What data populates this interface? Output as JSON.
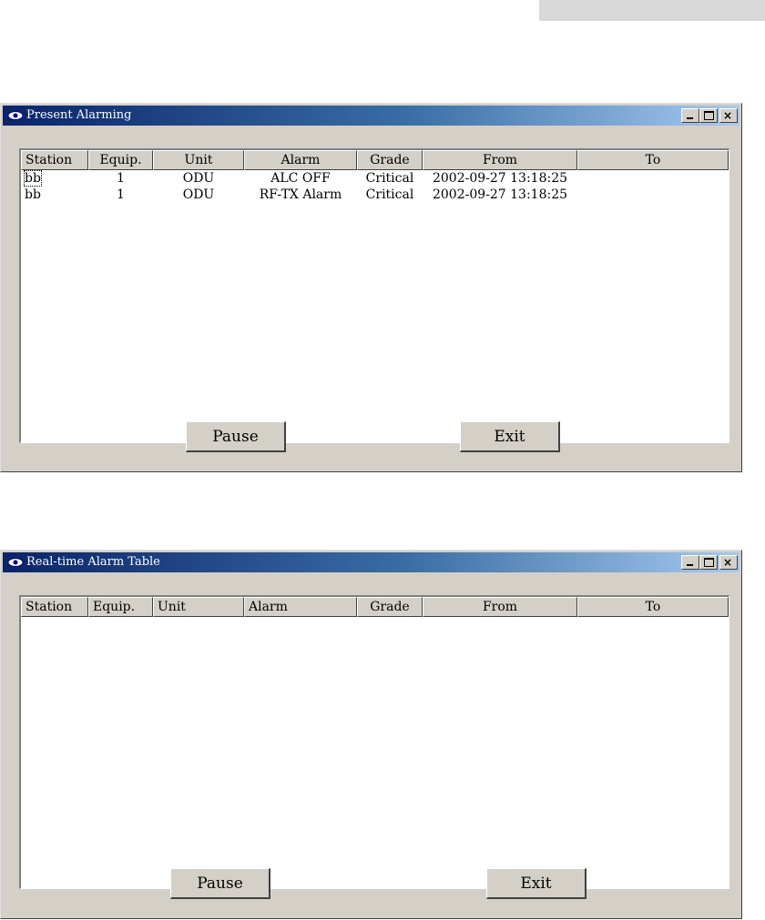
{
  "window1": {
    "title": "Present Alarming",
    "columns": [
      "Station",
      "Equip.",
      "Unit",
      "Alarm",
      "Grade",
      "From",
      "To"
    ],
    "rows": [
      {
        "station": "bb",
        "equip": "1",
        "unit": "ODU",
        "alarm": "ALC OFF",
        "grade": "Critical",
        "from": "2002-09-27 13:18:25",
        "to": ""
      },
      {
        "station": "bb",
        "equip": "1",
        "unit": "ODU",
        "alarm": "RF-TX Alarm",
        "grade": "Critical",
        "from": "2002-09-27 13:18:25",
        "to": ""
      }
    ],
    "pause_label": "Pause",
    "exit_label": "Exit"
  },
  "window2": {
    "title": "Real-time Alarm Table",
    "columns": [
      "Station",
      "Equip.",
      "Unit",
      "Alarm",
      "Grade",
      "From",
      "To"
    ],
    "rows": [],
    "pause_label": "Pause",
    "exit_label": "Exit"
  },
  "titlebar_buttons": {
    "minimize": "_",
    "close": "×"
  },
  "colors": {
    "face": "#d4d0c8",
    "title_start": "#0a246a",
    "title_end": "#a6caf0"
  }
}
